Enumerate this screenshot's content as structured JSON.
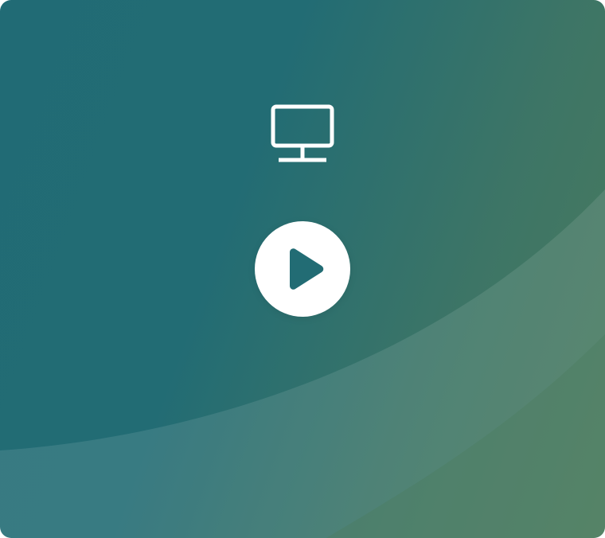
{
  "player": {
    "icons": {
      "media_type": "monitor-icon",
      "action": "play-icon"
    },
    "colors": {
      "gradient_start": "#216b75",
      "gradient_end": "#4a7b5d",
      "band": "#ffffff",
      "icon": "#ffffff",
      "play_glyph": "#226c74"
    }
  }
}
